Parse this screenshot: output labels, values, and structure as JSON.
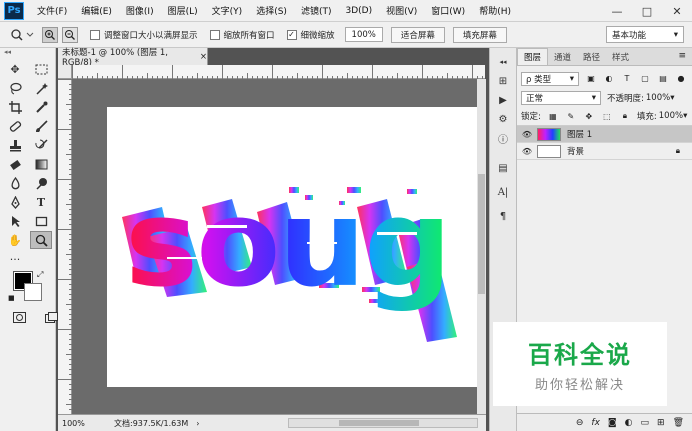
{
  "menubar": {
    "logo": "Ps",
    "items": [
      "文件(F)",
      "编辑(E)",
      "图像(I)",
      "图层(L)",
      "文字(Y)",
      "选择(S)",
      "滤镜(T)",
      "3D(D)",
      "视图(V)",
      "窗口(W)",
      "帮助(H)"
    ],
    "minimize": "—",
    "maximize": "□",
    "close": "✕"
  },
  "options": {
    "resize_windows": "调整窗口大小以满屏显示",
    "zoom_all": "缩放所有窗口",
    "scrubby_zoom": "细微缩放",
    "zoom_value": "100%",
    "fit_screen": "适合屏幕",
    "fill_screen": "填充屏幕",
    "workspace": "基本功能"
  },
  "document": {
    "tab_title": "未标题-1 @ 100% (图层 1, RGB/8) *",
    "tab_close": "×",
    "status_zoom": "100%",
    "status_doc": "文档:937.5K/1.63M",
    "art_text": "soug"
  },
  "layers_panel": {
    "tabs": [
      "图层",
      "通道",
      "路径",
      "样式"
    ],
    "filter_kind": "ρ 类型",
    "blend_mode": "正常",
    "opacity_label": "不透明度:",
    "opacity_value": "100%",
    "lock_label": "锁定:",
    "fill_label": "填充:",
    "fill_value": "100%",
    "layers": [
      {
        "name": "图层 1",
        "selected": true
      },
      {
        "name": "背景",
        "selected": false
      }
    ]
  },
  "watermark": {
    "title": "百科全说",
    "subtitle": "助你轻松解决"
  },
  "colors": {
    "accent_green": "#1aa84a",
    "foreground": "#000000",
    "background": "#ffffff"
  }
}
